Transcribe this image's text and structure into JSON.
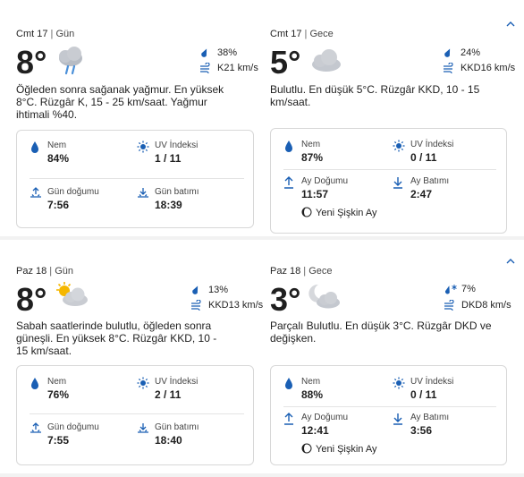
{
  "colors": {
    "accent": "#1a5fb4",
    "text": "#1f1f1f",
    "border": "#d8d8d8"
  },
  "days": [
    {
      "day": {
        "date": "Cmt 17",
        "period": "Gün",
        "temp": "8°",
        "icon": "cloud-rain-icon",
        "precip": "38%",
        "wind": "K21 km/s",
        "desc": "Öğleden sonra sağanak yağmur. En yüksek 8°C. Rüzgâr K, 15 - 25 km/saat. Yağmur ihtimali %40.",
        "details": {
          "humidity_label": "Nem",
          "humidity": "84%",
          "uv_label": "UV İndeksi",
          "uv": "1 / 11",
          "rise_label": "Gün doğumu",
          "rise": "7:56",
          "set_label": "Gün batımı",
          "set": "18:39"
        }
      },
      "night": {
        "date": "Cmt 17",
        "period": "Gece",
        "temp": "5°",
        "icon": "cloud-icon",
        "precip": "24%",
        "wind": "KKD16 km/s",
        "desc": "Bulutlu. En düşük 5°C. Rüzgâr KKD, 10 - 15 km/saat.",
        "details": {
          "humidity_label": "Nem",
          "humidity": "87%",
          "uv_label": "UV İndeksi",
          "uv": "0 / 11",
          "rise_label": "Ay Doğumu",
          "rise": "11:57",
          "set_label": "Ay Batımı",
          "set": "2:47",
          "moon_phase": "Yeni Şişkin Ay"
        }
      }
    },
    {
      "day": {
        "date": "Paz 18",
        "period": "Gün",
        "temp": "8°",
        "icon": "partly-sunny-icon",
        "precip": "13%",
        "wind": "KKD13 km/s",
        "desc": "Sabah saatlerinde bulutlu, öğleden sonra güneşli. En yüksek 8°C. Rüzgâr KKD, 10 - 15 km/saat.",
        "details": {
          "humidity_label": "Nem",
          "humidity": "76%",
          "uv_label": "UV İndeksi",
          "uv": "2 / 11",
          "rise_label": "Gün doğumu",
          "rise": "7:55",
          "set_label": "Gün batımı",
          "set": "18:40"
        }
      },
      "night": {
        "date": "Paz 18",
        "period": "Gece",
        "temp": "3°",
        "icon": "partly-cloudy-night-icon",
        "precip": "7%",
        "wind": "DKD8 km/s",
        "desc": "Parçalı Bulutlu. En düşük 3°C. Rüzgâr DKD ve değişken.",
        "details": {
          "humidity_label": "Nem",
          "humidity": "88%",
          "uv_label": "UV İndeksi",
          "uv": "0 / 11",
          "rise_label": "Ay Doğumu",
          "rise": "12:41",
          "set_label": "Ay Batımı",
          "set": "3:56",
          "moon_phase": "Yeni Şişkin Ay"
        }
      }
    }
  ]
}
